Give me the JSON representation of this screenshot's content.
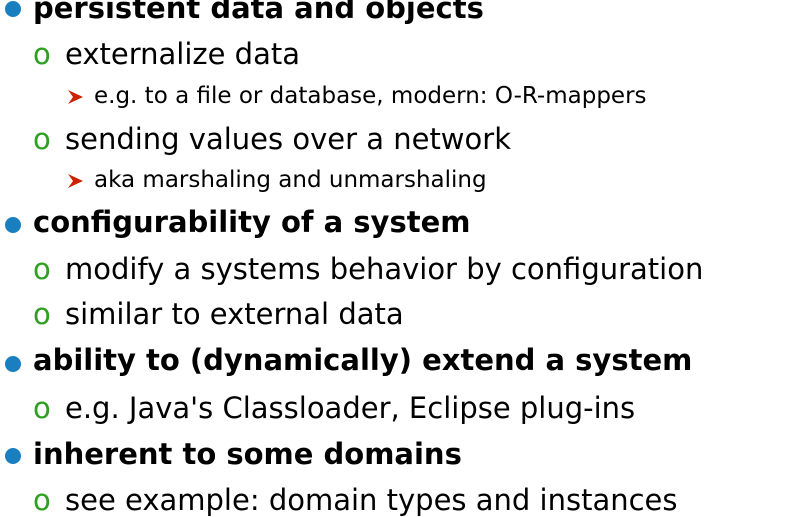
{
  "colors": {
    "level1_bullet": "#1a7fbf",
    "level2_marker": "#2ea020",
    "level3_arrow": "#cc2200",
    "text": "#000000"
  },
  "icons": {
    "level1": "filled-circle-bullet",
    "level2": "letter-o-bullet",
    "level3": "arrowhead-bullet"
  },
  "items": [
    {
      "level": 1,
      "text": "persistent data and objects"
    },
    {
      "level": 2,
      "marker": "o",
      "text": "externalize data"
    },
    {
      "level": 3,
      "text": "e.g. to a file or database, modern: O-R-mappers"
    },
    {
      "level": 2,
      "marker": "o",
      "text": "sending values over a network"
    },
    {
      "level": 3,
      "text": "aka marshaling and unmarshaling"
    },
    {
      "level": 1,
      "text": "configurability of a system"
    },
    {
      "level": 2,
      "marker": "o",
      "text": "modify a systems behavior by configuration"
    },
    {
      "level": 2,
      "marker": "o",
      "text": "similar to external data"
    },
    {
      "level": 1,
      "text": "ability to (dynamically) extend a system"
    },
    {
      "level": 2,
      "marker": "o",
      "text": "e.g. Java's Classloader, Eclipse plug-ins"
    },
    {
      "level": 1,
      "text": "inherent to some domains"
    },
    {
      "level": 2,
      "marker": "o",
      "text": "see example: domain types and instances"
    }
  ]
}
